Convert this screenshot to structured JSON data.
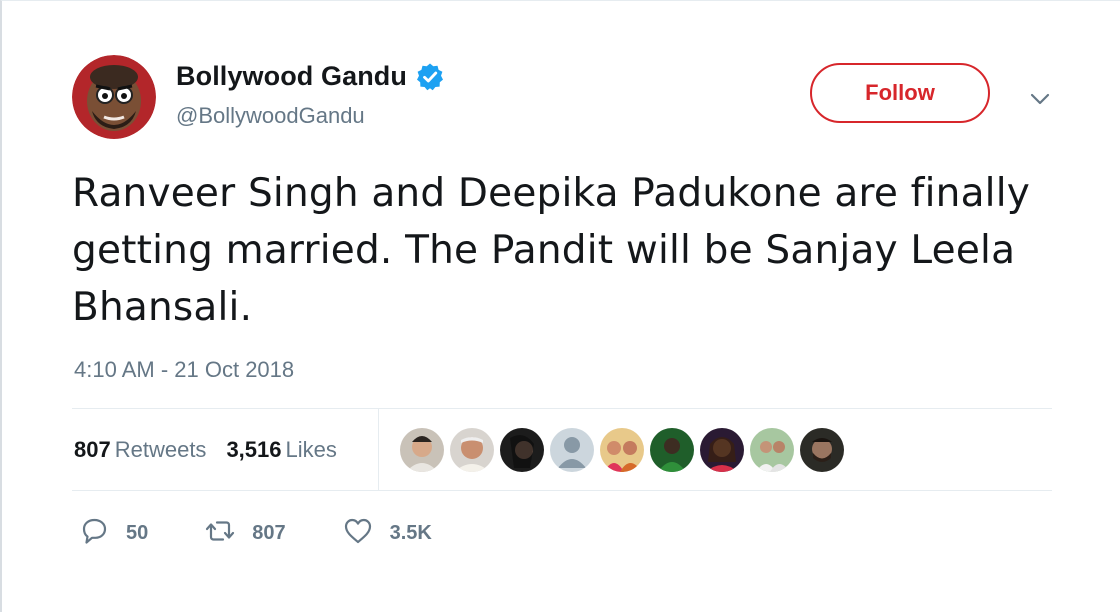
{
  "user": {
    "display_name": "Bollywood Gandu",
    "handle": "@BollywoodGandu",
    "verified": true
  },
  "follow_label": "Follow",
  "tweet": {
    "text": "Ranveer Singh and Deepika Padukone are finally getting married. The Pandit will be Sanjay Leela Bhansali.",
    "timestamp": "4:10 AM - 21 Oct 2018"
  },
  "stats": {
    "retweets_count": "807",
    "retweets_label": "Retweets",
    "likes_count": "3,516",
    "likes_label": "Likes"
  },
  "actions": {
    "reply_count": "50",
    "retweet_count": "807",
    "like_count": "3.5K"
  },
  "colors": {
    "follow_accent": "#d7262b",
    "verified_blue": "#1da1f2",
    "muted_text": "#657786"
  },
  "icons": [
    "verified-badge-icon",
    "chevron-down-icon",
    "reply-icon",
    "retweet-icon",
    "heart-icon"
  ]
}
